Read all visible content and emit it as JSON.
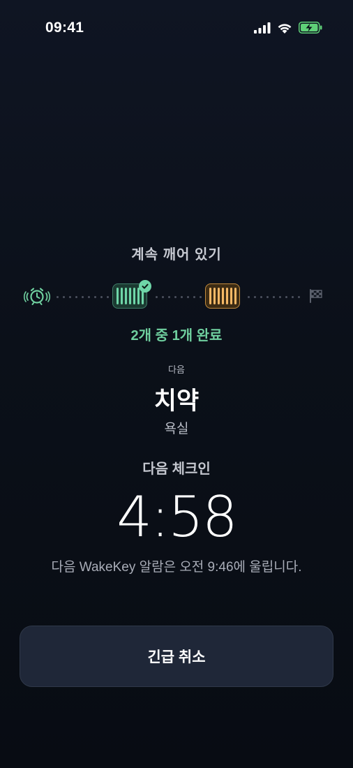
{
  "status_bar": {
    "time": "09:41",
    "icons": [
      "cellular-signal-icon",
      "wifi-icon",
      "battery-charging-icon"
    ],
    "battery_color": "#5fd078"
  },
  "progress": {
    "title": "계속 깨어 있기",
    "summary": "2개 중 1개 완료",
    "completed": 1,
    "total": 2,
    "steps": [
      {
        "state": "done",
        "color": "#6fd6a8"
      },
      {
        "state": "current",
        "color": "#f5b866"
      }
    ]
  },
  "next_task": {
    "label": "다음",
    "name": "치약",
    "location": "욕실"
  },
  "checkin": {
    "label": "다음 체크인",
    "countdown": "4:58",
    "message": "다음 WakeKey 알람은 오전 9:46에 울립니다."
  },
  "actions": {
    "emergency_cancel_label": "긴급 취소"
  },
  "colors": {
    "background": "#0b1019",
    "accent_green": "#6fcf9f",
    "accent_orange": "#f5b866",
    "button_bg": "#1f2738"
  }
}
